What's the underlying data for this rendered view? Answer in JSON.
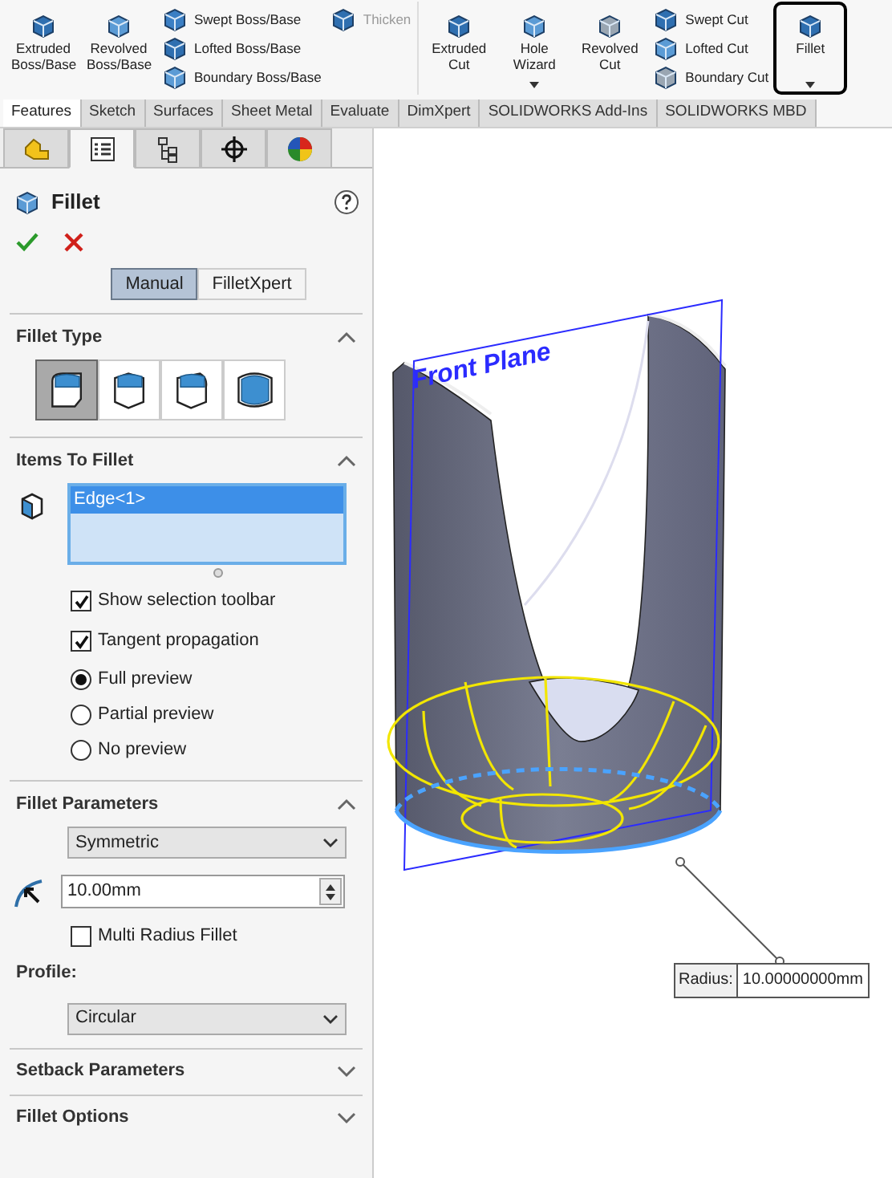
{
  "ribbon": {
    "groups": [
      {
        "columns": [
          {
            "kind": "large",
            "command": {
              "label": "Extruded Boss/Base"
            }
          },
          {
            "kind": "large",
            "command": {
              "label": "Revolved Boss/Base"
            }
          },
          {
            "kind": "stack",
            "commands": [
              {
                "label": "Swept Boss/Base",
                "disabled": false
              },
              {
                "label": "Lofted Boss/Base",
                "disabled": false
              },
              {
                "label": "Boundary Boss/Base",
                "disabled": false
              }
            ]
          },
          {
            "kind": "stack",
            "commands": [
              {
                "label": "Thicken",
                "disabled": true
              }
            ]
          }
        ]
      },
      {
        "columns": [
          {
            "kind": "large",
            "command": {
              "label": "Extruded Cut"
            }
          },
          {
            "kind": "large",
            "command": {
              "label": "Hole Wizard",
              "dropdown": true
            }
          },
          {
            "kind": "large",
            "command": {
              "label": "Revolved Cut"
            }
          },
          {
            "kind": "stack",
            "commands": [
              {
                "label": "Swept Cut",
                "disabled": false
              },
              {
                "label": "Lofted Cut",
                "disabled": false
              },
              {
                "label": "Boundary Cut",
                "disabled": false
              }
            ]
          },
          {
            "kind": "large",
            "command": {
              "label": "Fillet",
              "dropdown": true,
              "highlighted": true
            }
          }
        ]
      }
    ]
  },
  "tabs": [
    {
      "label": "Features",
      "selected": true
    },
    {
      "label": "Sketch",
      "selected": false
    },
    {
      "label": "Surfaces",
      "selected": false
    },
    {
      "label": "Sheet Metal",
      "selected": false
    },
    {
      "label": "Evaluate",
      "selected": false
    },
    {
      "label": "DimXpert",
      "selected": false
    },
    {
      "label": "SOLIDWORKS Add-Ins",
      "selected": false
    },
    {
      "label": "SOLIDWORKS MBD",
      "selected": false
    }
  ],
  "panel_tabs": [
    {
      "selected": false
    },
    {
      "selected": true
    },
    {
      "selected": false
    },
    {
      "selected": false
    },
    {
      "selected": false
    }
  ],
  "property_manager": {
    "title": "Fillet",
    "modes": [
      {
        "label": "Manual",
        "selected": true
      },
      {
        "label": "FilletXpert",
        "selected": false
      }
    ],
    "sections": [
      {
        "kind": "fillet_type",
        "title": "Fillet Type",
        "expanded": true,
        "types": [
          {
            "selected": true
          },
          {
            "selected": false
          },
          {
            "selected": false
          },
          {
            "selected": false
          }
        ]
      },
      {
        "kind": "items",
        "title": "Items To Fillet",
        "expanded": true,
        "items": [
          {
            "label": "Edge<1>",
            "selected": true
          }
        ],
        "checkboxes": [
          {
            "label": "Show selection toolbar",
            "checked": true
          },
          {
            "label": "Tangent propagation",
            "checked": true
          }
        ],
        "radios": [
          {
            "label": "Full preview",
            "selected": true
          },
          {
            "label": "Partial preview",
            "selected": false
          },
          {
            "label": "No preview",
            "selected": false
          }
        ]
      },
      {
        "kind": "parameters",
        "title": "Fillet Parameters",
        "expanded": true,
        "method": "Symmetric",
        "radius": "10.00mm",
        "multi_radius": {
          "label": "Multi Radius Fillet",
          "checked": false
        },
        "profile_label": "Profile:",
        "profile": "Circular"
      },
      {
        "title": "Setback Parameters",
        "expanded": false
      },
      {
        "title": "Fillet Options",
        "expanded": false
      }
    ]
  },
  "viewport": {
    "plane_label": "Front Plane",
    "dimension": {
      "label": "Radius:",
      "value": "10.00000000mm"
    }
  }
}
